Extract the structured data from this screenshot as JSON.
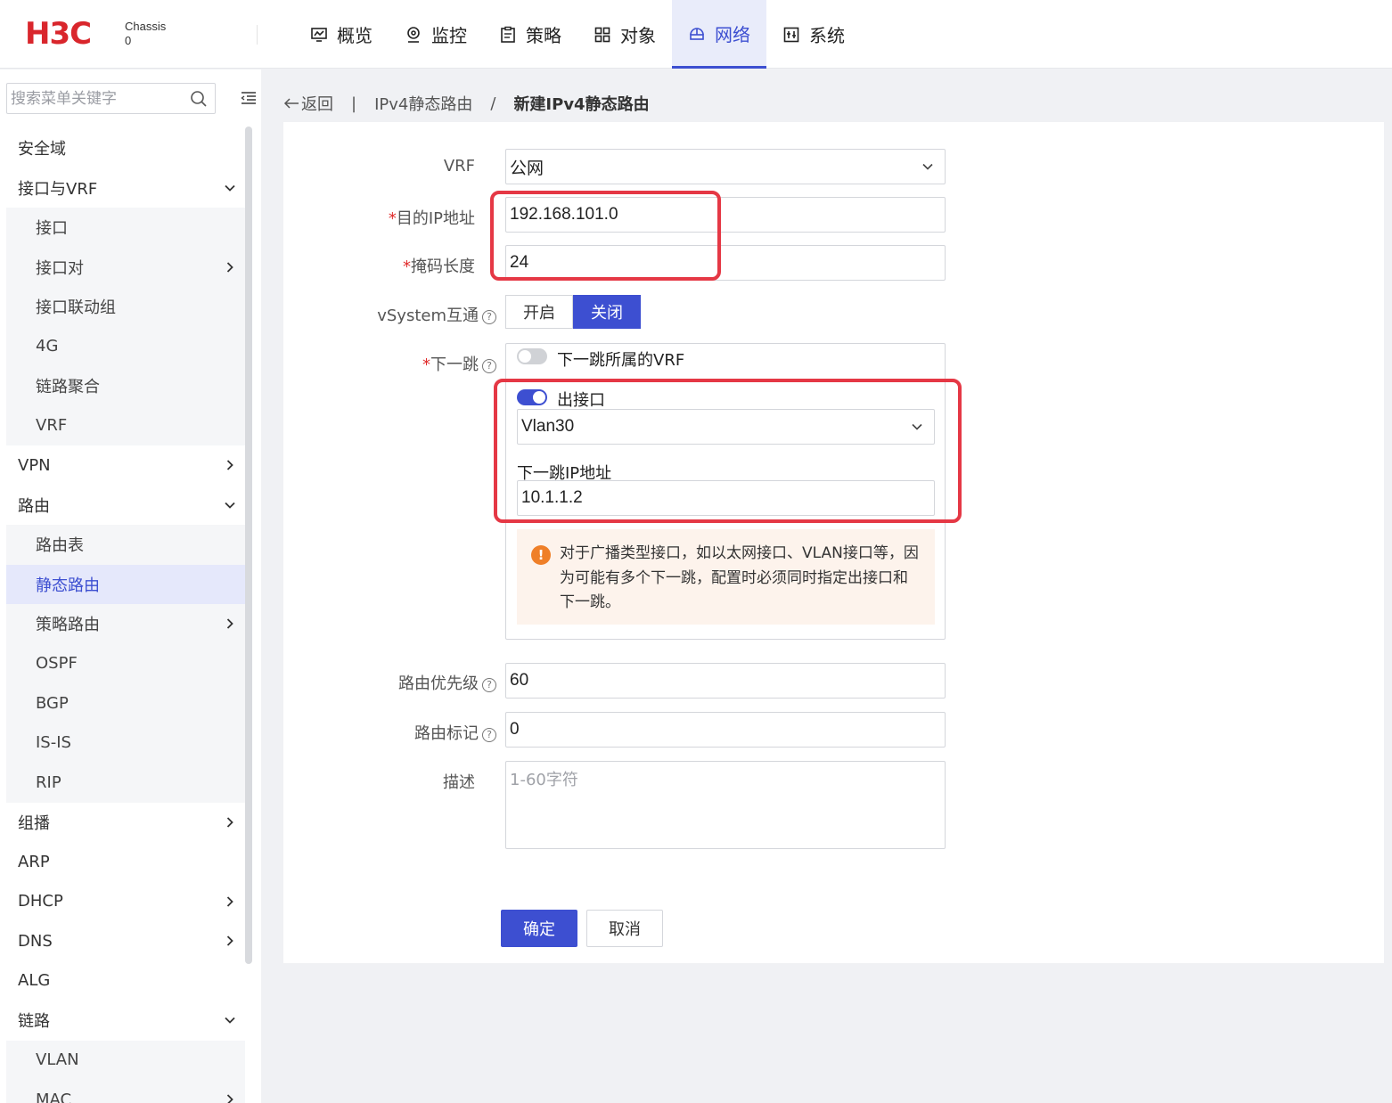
{
  "header": {
    "logo": "H3C",
    "chassis_label": "Chassis",
    "chassis_value": "0",
    "nav": [
      {
        "label": "概览",
        "icon": "overview-icon"
      },
      {
        "label": "监控",
        "icon": "monitor-icon"
      },
      {
        "label": "策略",
        "icon": "policy-icon"
      },
      {
        "label": "对象",
        "icon": "object-icon"
      },
      {
        "label": "网络",
        "icon": "network-icon",
        "active": true
      },
      {
        "label": "系统",
        "icon": "system-icon"
      }
    ]
  },
  "sidebar": {
    "search_placeholder": "搜索菜单关键字",
    "items": [
      {
        "label": "安全域"
      },
      {
        "label": "接口与VRF",
        "chevron": "down"
      },
      {
        "label": "接口",
        "sub": true
      },
      {
        "label": "接口对",
        "sub": true,
        "chevron": "right"
      },
      {
        "label": "接口联动组",
        "sub": true
      },
      {
        "label": "4G",
        "sub": true
      },
      {
        "label": "链路聚合",
        "sub": true
      },
      {
        "label": "VRF",
        "sub": true
      },
      {
        "label": "VPN",
        "chevron": "right"
      },
      {
        "label": "路由",
        "chevron": "down"
      },
      {
        "label": "路由表",
        "sub": true
      },
      {
        "label": "静态路由",
        "sub": true,
        "active": true
      },
      {
        "label": "策略路由",
        "sub": true,
        "chevron": "right"
      },
      {
        "label": "OSPF",
        "sub": true
      },
      {
        "label": "BGP",
        "sub": true
      },
      {
        "label": "IS-IS",
        "sub": true
      },
      {
        "label": "RIP",
        "sub": true
      },
      {
        "label": "组播",
        "chevron": "right"
      },
      {
        "label": "ARP"
      },
      {
        "label": "DHCP",
        "chevron": "right"
      },
      {
        "label": "DNS",
        "chevron": "right"
      },
      {
        "label": "ALG"
      },
      {
        "label": "链路",
        "chevron": "down"
      },
      {
        "label": "VLAN",
        "sub": true
      },
      {
        "label": "MAC",
        "sub": true,
        "chevron": "right"
      }
    ]
  },
  "breadcrumb": {
    "back": "返回",
    "sep": "|",
    "parent": "IPv4静态路由",
    "slash": "/",
    "current": "新建IPv4静态路由"
  },
  "form": {
    "vrf_label": "VRF",
    "vrf_value": "公网",
    "dest_ip_label": "目的IP地址",
    "dest_ip_value": "192.168.101.0",
    "mask_label": "掩码长度",
    "mask_value": "24",
    "vsystem_label": "vSystem互通",
    "vsystem_on": "开启",
    "vsystem_off": "关闭",
    "nexthop_label": "下一跳",
    "nexthop_vrf_toggle": "下一跳所属的VRF",
    "out_iface_toggle": "出接口",
    "out_iface_value": "Vlan30",
    "nexthop_ip_label": "下一跳IP地址",
    "nexthop_ip_value": "10.1.1.2",
    "warning_text": "对于广播类型接口，如以太网接口、VLAN接口等，因为可能有多个下一跳，配置时必须同时指定出接口和下一跳。",
    "priority_label": "路由优先级",
    "priority_value": "60",
    "tag_label": "路由标记",
    "tag_value": "0",
    "desc_label": "描述",
    "desc_placeholder": "1-60字符",
    "required_mark": "*",
    "help_mark": "?",
    "warn_mark": "!"
  },
  "buttons": {
    "ok": "确定",
    "cancel": "取消"
  },
  "colors": {
    "accent": "#3d4fd1",
    "brand": "#d9262c",
    "highlight": "#e53845",
    "warning": "#ef7f28"
  }
}
